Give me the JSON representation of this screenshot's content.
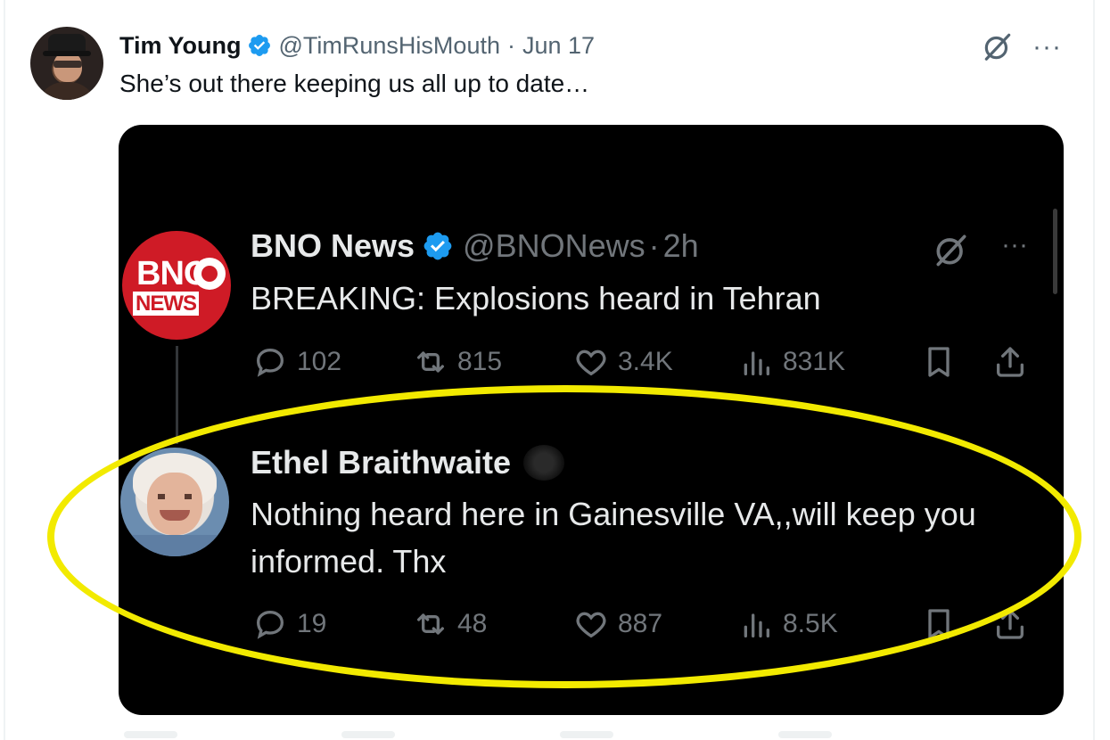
{
  "outer_tweet": {
    "display_name": "Tim Young",
    "handle": "@TimRunsHisMouth",
    "separator": "·",
    "date": "Jun 17",
    "text": "She’s out there keeping us all up to date…",
    "more_label": "···"
  },
  "embedded": {
    "first_tweet": {
      "display_name": "BNO News",
      "handle": "@BNONews",
      "separator": "·",
      "time": "2h",
      "text": "BREAKING: Explosions heard in Tehran",
      "avatar_text_top": "BNO",
      "avatar_text_bottom": "NEWS",
      "more_label": "···",
      "actions": {
        "replies": "102",
        "reposts": "815",
        "likes": "3.4K",
        "views": "831K"
      }
    },
    "reply_tweet": {
      "display_name": "Ethel Braithwaite",
      "text": "Nothing heard here in Gainesville VA,,will keep you informed. Thx",
      "actions": {
        "replies": "19",
        "reposts": "48",
        "likes": "887",
        "views": "8.5K"
      }
    }
  },
  "colors": {
    "verified_blue": "#1d9bf0",
    "highlight_yellow": "#f2ea00",
    "bno_red": "#cf1b26"
  },
  "icons": [
    "verified-badge-icon",
    "grok-icon",
    "more-icon",
    "reply-icon",
    "repost-icon",
    "like-icon",
    "views-icon",
    "bookmark-icon",
    "share-icon"
  ]
}
